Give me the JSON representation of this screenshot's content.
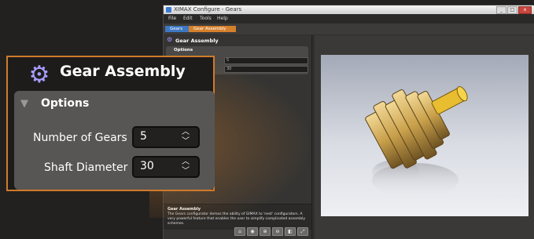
{
  "window": {
    "title": "XIMAX Configure - Gears",
    "controls": [
      "_",
      "□",
      "x"
    ]
  },
  "menu": [
    "File",
    "Edit",
    "Tools",
    "Help"
  ],
  "breadcrumb": [
    "Gears",
    "Gear Assembly"
  ],
  "left_panel": {
    "title": "Gear Assembly",
    "options_title": "Options",
    "fields": [
      {
        "label": "Number of Gears",
        "value": "5"
      },
      {
        "label": "Shaft Diameter",
        "value": "30"
      }
    ]
  },
  "description": {
    "title": "Gear Assembly",
    "text": "The Gears configurator demos the ability of GIMAX to 'nest' configurators. A very powerful feature that enables the user to simplify complicated assembly schemes."
  },
  "toolbar": [
    "⌂",
    "◉",
    "⊕",
    "⊖",
    "◧",
    "⤢"
  ],
  "callout": {
    "title": "Gear Assembly",
    "options_title": "Options",
    "fields": [
      {
        "label": "Number of Gears",
        "value": "5"
      },
      {
        "label": "Shaft Diameter",
        "value": "30"
      }
    ]
  },
  "colors": {
    "accent": "#d07b2a",
    "breadcrumb_blue": "#3e78c3",
    "icon": "#a89cff"
  }
}
